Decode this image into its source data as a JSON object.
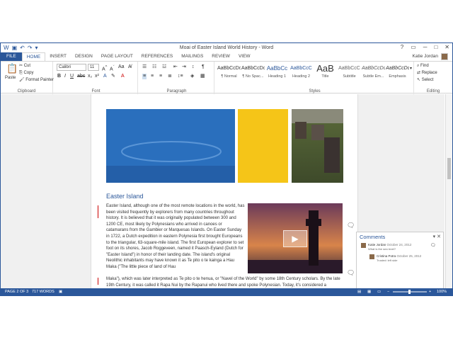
{
  "window": {
    "title": "Moai of Easter Island World History - Word",
    "controls": [
      "?",
      "▭",
      "─",
      "□",
      "✕"
    ]
  },
  "quick_access": {
    "icons": [
      "word-icon",
      "save-icon",
      "undo-icon",
      "redo-icon",
      "customize-icon"
    ]
  },
  "ribbon_tabs": [
    "FILE",
    "HOME",
    "INSERT",
    "DESIGN",
    "PAGE LAYOUT",
    "REFERENCES",
    "MAILINGS",
    "REVIEW",
    "VIEW"
  ],
  "active_tab": "HOME",
  "user": {
    "name": "Katie Jordan"
  },
  "clipboard": {
    "paste": "Paste",
    "cut": "Cut",
    "copy": "Copy",
    "format_painter": "Format Painter",
    "label": "Clipboard"
  },
  "font": {
    "name": "Calibri",
    "size": "11",
    "label": "Font"
  },
  "paragraph": {
    "label": "Paragraph"
  },
  "styles": {
    "label": "Styles",
    "items": [
      {
        "preview": "AaBbCcDc",
        "name": "¶ Normal"
      },
      {
        "preview": "AaBbCcDc",
        "name": "¶ No Spac..."
      },
      {
        "preview": "AaBbCc",
        "name": "Heading 1"
      },
      {
        "preview": "AaBbCcC",
        "name": "Heading 2"
      },
      {
        "preview": "AaB",
        "name": "Title"
      },
      {
        "preview": "AaBbCcC",
        "name": "Subtitle"
      },
      {
        "preview": "AaBbCcDc",
        "name": "Subtle Em..."
      },
      {
        "preview": "AaBbCcDc",
        "name": "Emphasis"
      }
    ]
  },
  "editing": {
    "find": "Find",
    "replace": "Replace",
    "select": "Select",
    "label": "Editing"
  },
  "document": {
    "heading": "Easter Island",
    "paragraph": "Easter Island, although one of the most remote locations in the world, has been visited frequently by explorers from many countries throughout history. It is believed that it was originally populated between 300 and 1200 CE, most likely by Polynesians who arrived in canoes or catamarans from the Gambier or Marquesas Islands. On Easter Sunday in 1722, a Dutch expedition in eastern Polynesia first brought Europeans to the triangular, 63-square-mile island. The first European explorer to set foot on its shores, Jacob Roggeveen, named it Paasch-Eyland (Dutch for \"Easter Island\") in honor of their landing date. The island's original Neolithic inhabitants may have known it as Te pito o te kainga a Hau Maka (\"The little piece of land of Hau",
    "paragraph_full": "Maka\"), which was later interpreted as Te pito o te henua, or \"Navel of the World\" by some 18th Century scholars. By the late 19th Century, it was called it Rapa Nui by the Rapanui who lived there and spoke Polynesian. Today, it's considered a"
  },
  "comments": {
    "title": "Comments",
    "items": [
      {
        "author": "Katie Jordan",
        "date": "October 24, 2012",
        "text": "What is the sea level?"
      },
      {
        "author": "Cristina Potra",
        "date": "October 25, 2012",
        "text": "Trusted: left side"
      }
    ]
  },
  "status": {
    "page": "PAGE 2 OF 3",
    "words": "717 WORDS",
    "zoom": "100%"
  },
  "colors": {
    "accent": "#2b579a",
    "yellow": "#f5c518",
    "ocean": "#2a6fbd"
  }
}
